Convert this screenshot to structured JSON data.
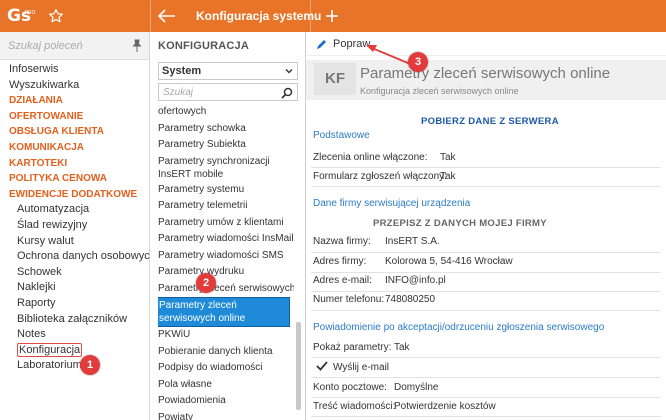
{
  "app": {
    "logo_text": "Gs",
    "logo_sup": "PRO",
    "window_title": "Konfiguracja systemu",
    "accent_color": "#e8742a"
  },
  "sidebar": {
    "search_placeholder": "Szukaj poleceń",
    "items": [
      {
        "label": "Infoserwis",
        "kind": "item"
      },
      {
        "label": "Wyszukiwarka",
        "kind": "item"
      },
      {
        "label": "DZIAŁANIA",
        "kind": "cat"
      },
      {
        "label": "OFERTOWANIE",
        "kind": "cat"
      },
      {
        "label": "OBSŁUGA KLIENTA",
        "kind": "cat"
      },
      {
        "label": "KOMUNIKACJA",
        "kind": "cat"
      },
      {
        "label": "KARTOTEKI",
        "kind": "cat"
      },
      {
        "label": "POLITYKA CENOWA",
        "kind": "cat"
      },
      {
        "label": "EWIDENCJE DODATKOWE",
        "kind": "cat"
      },
      {
        "label": "Automatyzacja",
        "kind": "sub"
      },
      {
        "label": "Ślad rewizyjny",
        "kind": "sub"
      },
      {
        "label": "Kursy walut",
        "kind": "sub"
      },
      {
        "label": "Ochrona danych osobowych",
        "kind": "sub"
      },
      {
        "label": "Schowek",
        "kind": "sub"
      },
      {
        "label": "Naklejki",
        "kind": "sub"
      },
      {
        "label": "Raporty",
        "kind": "sub"
      },
      {
        "label": "Biblioteka załączników",
        "kind": "sub"
      },
      {
        "label": "Notes",
        "kind": "sub"
      },
      {
        "label": "Konfiguracja",
        "kind": "sub",
        "active": true
      },
      {
        "label": "Laboratorium",
        "kind": "sub"
      }
    ]
  },
  "middle": {
    "header": "KONFIGURACJA",
    "select_value": "System",
    "search_placeholder": "Szukaj",
    "items": [
      "ofertowych",
      "Parametry schowka",
      "Parametry Subiekta",
      "Parametry synchronizacji InsERT mobile",
      "Parametry systemu",
      "Parametry telemetrii",
      "Parametry umów z klientami",
      "Parametry wiadomości InsMail",
      "Parametry wiadomości SMS",
      "Parametry wydruku",
      "Parametry zleceń serwisowych",
      "Parametry zleceń serwisowych online",
      "PKWiU",
      "Pobieranie danych klienta",
      "Podpisy do wiadomości",
      "Pola własne",
      "Powiadomienia",
      "Powiaty"
    ],
    "selected_index": 11
  },
  "content": {
    "toolbar_popraw": "Popraw",
    "badge": "KF",
    "title": "Parametry zleceń serwisowych online",
    "subtitle": "Konfiguracja zleceń serwisowych online",
    "btn_pobierz": "POBIERZ DANE Z SERWERA",
    "section_podstawowe": "Podstawowe",
    "row_zlecenia_label": "Zlecenia online włączone:",
    "row_zlecenia_value": "Tak",
    "row_formularz_label": "Formularz zgłoszeń włączony:",
    "row_formularz_value": "Tak",
    "section_firma": "Dane firmy serwisującej urządzenia",
    "btn_przepisz": "PRZEPISZ Z DANYCH MOJEJ FIRMY",
    "row_nazwa_label": "Nazwa firmy:",
    "row_nazwa_value": "InsERT S.A.",
    "row_adres_label": "Adres firmy:",
    "row_adres_value": "Kolorowa 5, 54-416 Wrocław",
    "row_email_label": "Adres e-mail:",
    "row_email_value": "INFO@info.pl",
    "row_tel_label": "Numer telefonu:",
    "row_tel_value": "748080250",
    "section_powiad": "Powiadomienie po akceptacji/odrzuceniu zgłoszenia serwisowego",
    "row_pokaz_label": "Pokaż parametry:",
    "row_pokaz_value": "Tak",
    "row_wyslij_label": "Wyślij e-mail",
    "row_konto_label": "Konto pocztowe:",
    "row_konto_value": "Domyślne",
    "row_tresc_label": "Treść wiadomości:",
    "row_tresc_value": "Potwierdzenie kosztów"
  },
  "callouts": {
    "c1": "1",
    "c2": "2",
    "c3": "3",
    "color": "#e23b3b"
  }
}
